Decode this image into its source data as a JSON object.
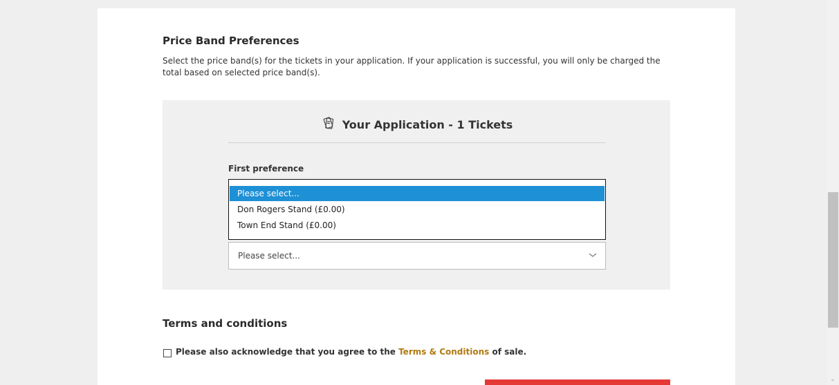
{
  "price_band": {
    "title": "Price Band Preferences",
    "description": "Select the price band(s) for the tickets in your application. If your application is successful, you will only be charged the total based on selected price band(s).",
    "application_header": "Your Application - 1 Tickets",
    "ticket_icon": "ticket-icon",
    "first_preference_label": "First preference",
    "dropdown_options": [
      "Please select...",
      "Don Rogers Stand (£0.00)",
      "Town End Stand (£0.00)"
    ],
    "second_select_value": "Please select..."
  },
  "terms": {
    "title": "Terms and conditions",
    "text_before": "Please also acknowledge that you agree to the",
    "link": "Terms & Conditions",
    "text_after": "of sale.",
    "checked": false
  },
  "colors": {
    "selected_option": "#1e90d6",
    "link": "#b07a12",
    "button": "#e53935"
  }
}
